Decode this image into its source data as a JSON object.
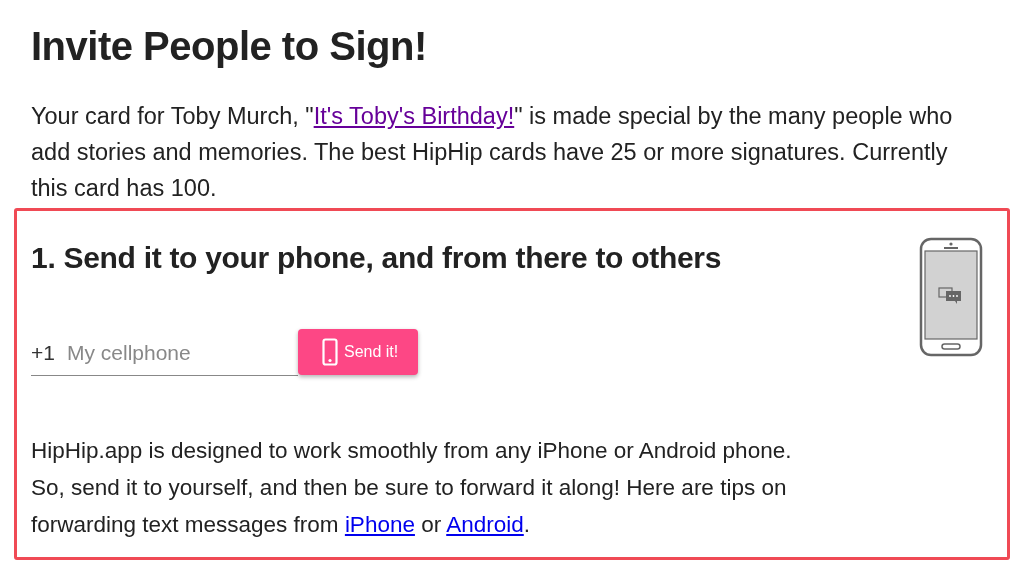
{
  "title": "Invite People to Sign!",
  "intro": {
    "before": "Your card for Toby Murch, \"",
    "link": "It's Toby's Birthday!",
    "after": "\" is made special by the many people who add stories and memories. The best HipHip cards have 25 or more signatures. Currently this card has 100."
  },
  "step": {
    "heading": "1. Send it to your phone, and from there to others",
    "prefix": "+1",
    "placeholder": "My cellphone",
    "button": "Send it!",
    "tips": [
      {
        "kind": "text",
        "text": "HipHip.app is designed to work smoothly from any iPhone or Android phone. So, send it to yourself, and then be sure to forward it along! Here are tips on forwarding text messages from "
      },
      {
        "kind": "link",
        "text": "iPhone"
      },
      {
        "kind": "text",
        "text": " or "
      },
      {
        "kind": "link",
        "text": "Android"
      },
      {
        "kind": "text",
        "text": "."
      }
    ]
  }
}
